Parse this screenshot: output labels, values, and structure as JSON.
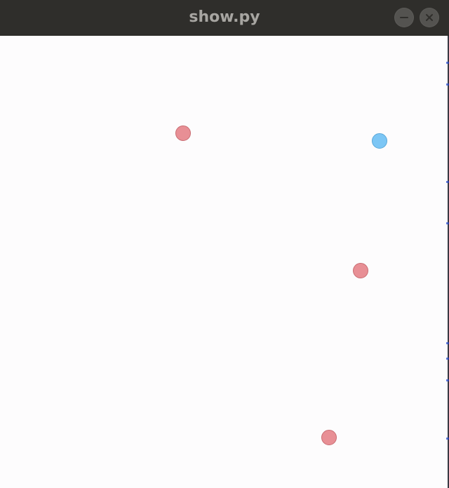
{
  "window": {
    "title": "show.py"
  },
  "controls": {
    "minimize_icon": "minimize-icon",
    "close_icon": "close-icon"
  },
  "canvas": {
    "background": "#fdfcfd",
    "dots": [
      {
        "id": "red-dot-1",
        "color": "#e88f95",
        "border": "#c96d73"
      },
      {
        "id": "blue-dot",
        "color": "#7cc6f5",
        "border": "#5aa8d9"
      },
      {
        "id": "red-dot-2",
        "color": "#e88f95",
        "border": "#c96d73"
      },
      {
        "id": "red-dot-3",
        "color": "#e88f95",
        "border": "#c96d73"
      }
    ]
  }
}
